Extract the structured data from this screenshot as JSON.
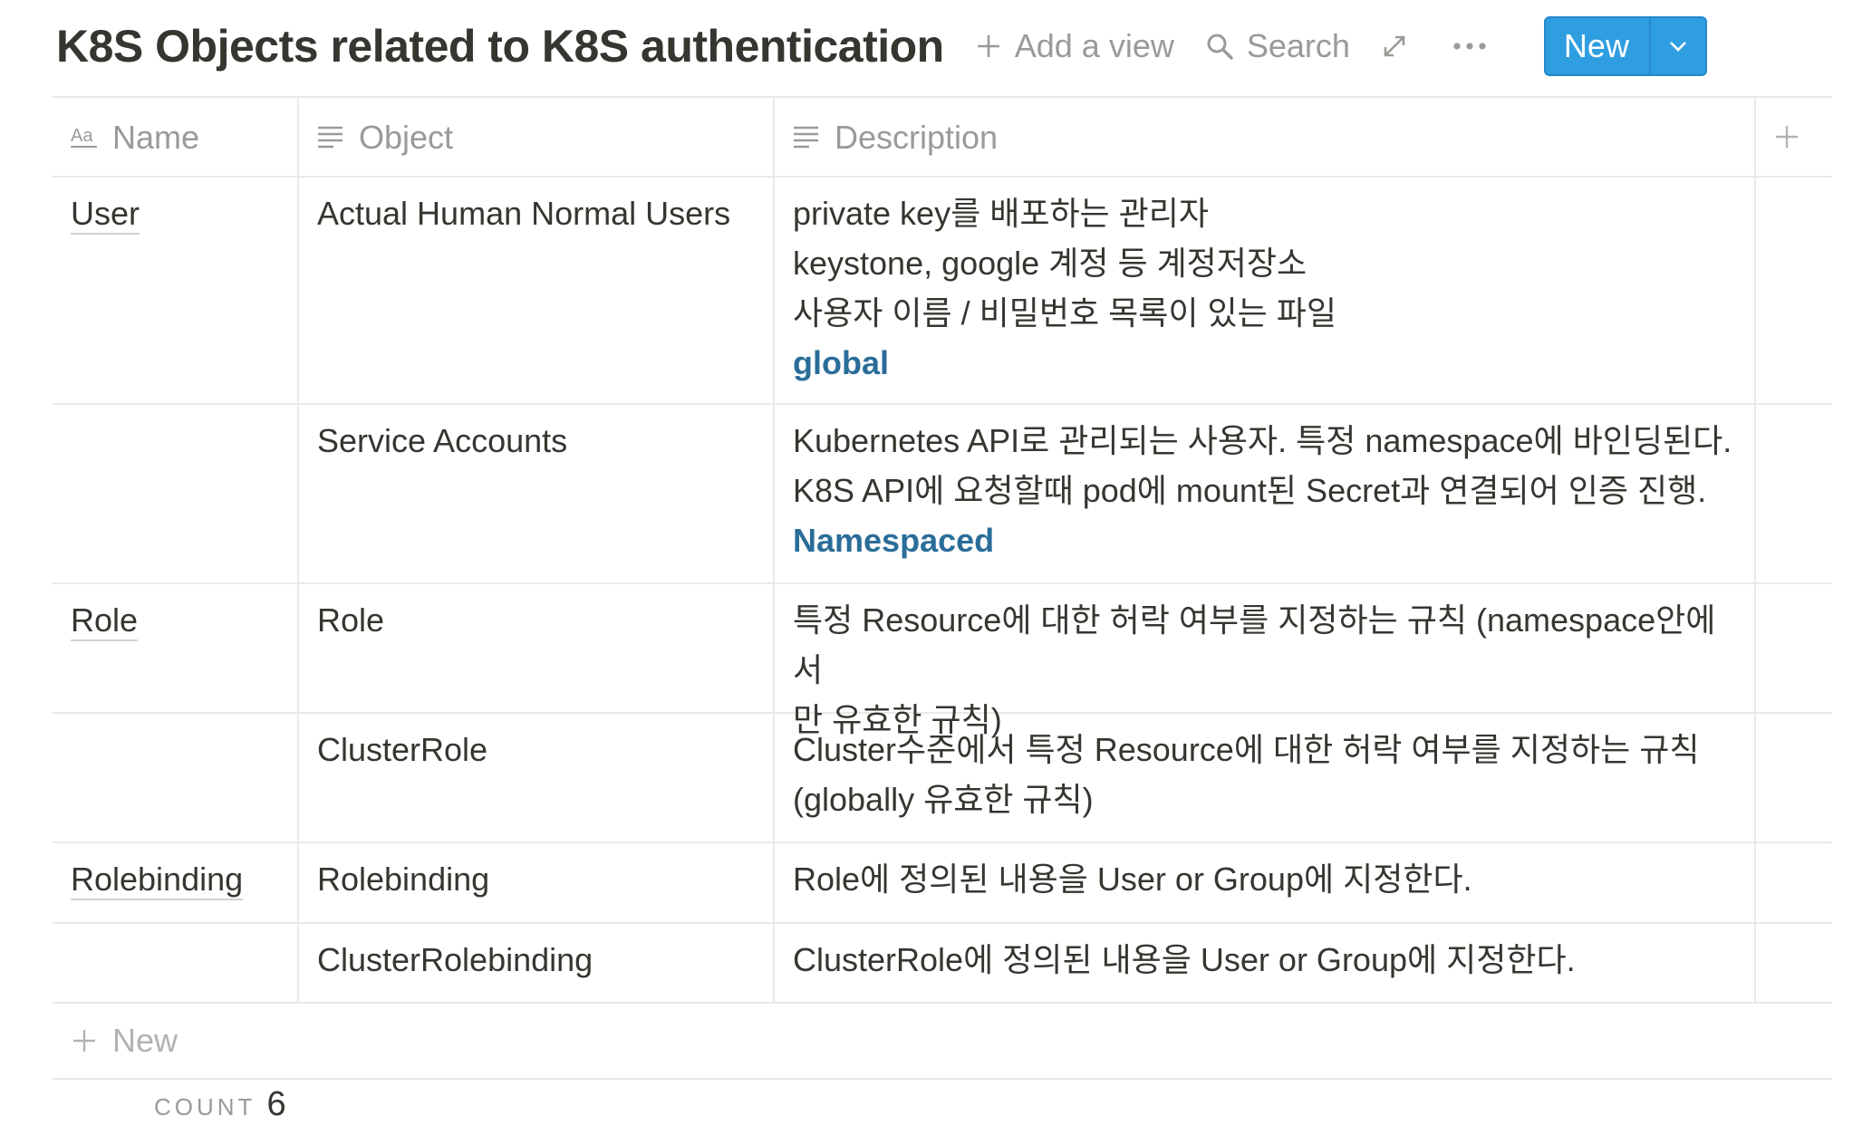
{
  "header": {
    "title": "K8S Objects related to K8S authentication",
    "add_view_label": "Add a view",
    "search_label": "Search",
    "new_label": "New"
  },
  "columns": {
    "name": "Name",
    "object": "Object",
    "description": "Description",
    "name_icon_text": "Aa"
  },
  "rows": [
    {
      "name": "User",
      "object": "Actual Human Normal Users",
      "description": [
        "private key를 배포하는 관리자",
        "keystone, google 계정 등 계정저장소",
        "사용자 이름 / 비밀번호 목록이 있는 파일"
      ],
      "scope": "global"
    },
    {
      "name": "",
      "object": "Service Accounts",
      "description": [
        "Kubernetes API로 관리되는 사용자. 특정 namespace에 바인딩된다.",
        "K8S API에 요청할때 pod에 mount된 Secret과 연결되어 인증 진행."
      ],
      "scope": "Namespaced"
    },
    {
      "name": "Role",
      "object": "Role",
      "description": [
        "특정 Resource에 대한 허락 여부를 지정하는 규칙 (namespace안에서",
        "만 유효한 규칙)"
      ],
      "scope": ""
    },
    {
      "name": "",
      "object": "ClusterRole",
      "description": [
        "Cluster수준에서 특정 Resource에 대한 허락 여부를 지정하는 규칙",
        "(globally 유효한 규칙)"
      ],
      "scope": ""
    },
    {
      "name": "Rolebinding",
      "object": "Rolebinding",
      "description": [
        "Role에 정의된 내용을 User or Group에 지정한다."
      ],
      "scope": ""
    },
    {
      "name": "",
      "object": "ClusterRolebinding",
      "description": [
        "ClusterRole에 정의된 내용을 User or Group에 지정한다."
      ],
      "scope": ""
    }
  ],
  "footer": {
    "new_row_label": "New",
    "count_label": "COUNT",
    "count_value": "6"
  },
  "colors": {
    "accent": "#2f9ee0",
    "tag": "#2a6d99",
    "text": "#37352f",
    "muted": "#9b9a97",
    "border": "#e9e9e7"
  }
}
